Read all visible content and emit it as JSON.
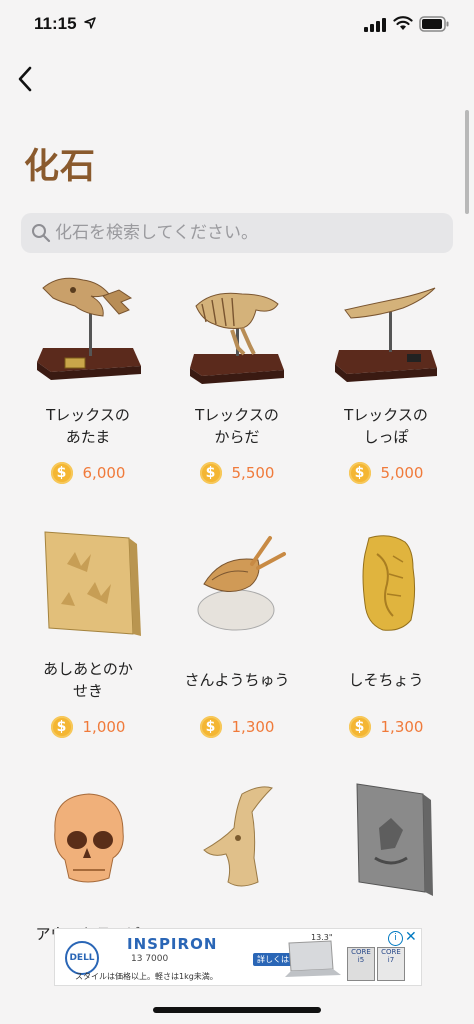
{
  "status": {
    "time": "11:15"
  },
  "nav": {
    "back_label": "<"
  },
  "page": {
    "title": "化石"
  },
  "search": {
    "placeholder": "化石を検索してください。"
  },
  "items": [
    {
      "name": "Tレックスの\nあたま",
      "price": "6,000"
    },
    {
      "name": "Tレックスの\nからだ",
      "price": "5,500"
    },
    {
      "name": "Tレックスの\nしっぽ",
      "price": "5,000"
    },
    {
      "name": "あしあとのか\nせき",
      "price": "1,000"
    },
    {
      "name": "さんようちゅう",
      "price": "1,300"
    },
    {
      "name": "しそちょう",
      "price": "1,300"
    },
    {
      "name": "アウストラロピ",
      "price": ""
    },
    {
      "name": "",
      "price": ""
    },
    {
      "name": "",
      "price": ""
    }
  ],
  "ad": {
    "brand": "DELL",
    "product": "INSPIRON",
    "model": "13 7000",
    "size": "13.3\"",
    "cta": "詳しくはこちら",
    "tagline": "スタイルは価格以上。軽さは1kg未満。",
    "chip1": "CORE i5",
    "chip2": "CORE i7"
  },
  "colors": {
    "title": "#8a5a2d",
    "price": "#f07a3a",
    "coin": "#f4b633"
  }
}
